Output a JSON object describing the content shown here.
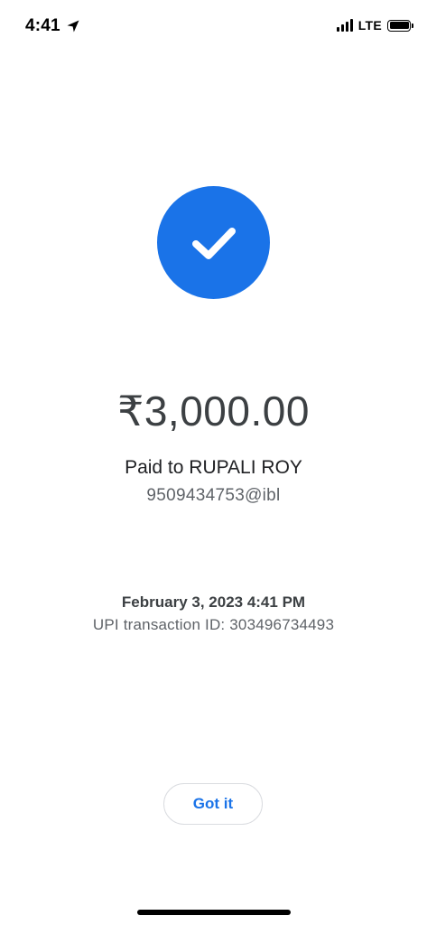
{
  "status_bar": {
    "time": "4:41",
    "network": "LTE",
    "icons": [
      "location-arrow-icon",
      "signal-bars-icon",
      "battery-icon"
    ]
  },
  "payment": {
    "status_icon": "check-icon",
    "accent_color": "#1a73e8",
    "amount": "₹3,000.00",
    "paid_to": "Paid to RUPALI ROY",
    "upi_id": "9509434753@ibl",
    "date": "February 3, 2023 4:41 PM",
    "transaction_id": "UPI transaction ID: 303496734493"
  },
  "actions": {
    "got_it_label": "Got it"
  }
}
